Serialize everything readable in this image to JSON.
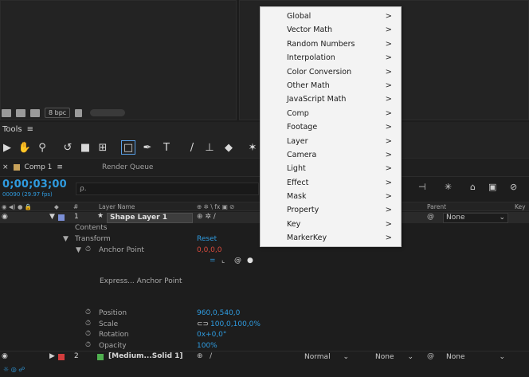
{
  "project": {
    "bpc": "8 bpc"
  },
  "tools": {
    "title": "Tools"
  },
  "tabs": {
    "comp": "Comp 1",
    "render_queue": "Render Queue"
  },
  "comp": {
    "timecode": "0;00;03;00",
    "frames": "00090 (29.97 fps)",
    "search_placeholder": "ρ."
  },
  "columns": {
    "hash": "#",
    "layer_name": "Layer Name",
    "parent": "Parent",
    "keys": "Key"
  },
  "layers": [
    {
      "number": "1",
      "name": "Shape Layer 1",
      "color": "#7b8fd6",
      "parent": "None"
    },
    {
      "number": "2",
      "name": "[Medium...Solid 1]",
      "color": "#d23c3c",
      "mode": "Normal",
      "trkmat": "None",
      "parent": "None"
    }
  ],
  "props": {
    "contents": "Contents",
    "transform": "Transform",
    "reset": "Reset",
    "anchor_point": "Anchor Point",
    "anchor_value": "0,0,0,0",
    "expression": "Express... Anchor Point",
    "position": "Position",
    "position_value": "960,0,540,0",
    "scale": "Scale",
    "scale_value": "100,0,100,0%",
    "rotation": "Rotation",
    "rotation_value": "0x+0,0°",
    "opacity": "Opacity",
    "opacity_value": "100%"
  },
  "menu": {
    "items": [
      "Global",
      "Vector Math",
      "Random Numbers",
      "Interpolation",
      "Color Conversion",
      "Other Math",
      "JavaScript Math",
      "Comp",
      "Footage",
      "Layer",
      "Camera",
      "Light",
      "Effect",
      "Mask",
      "Property",
      "Key",
      "MarkerKey"
    ],
    "arrow": ">"
  },
  "colors": {
    "accent": "#2f9bdf",
    "anchor_red": "#d94a3d"
  }
}
